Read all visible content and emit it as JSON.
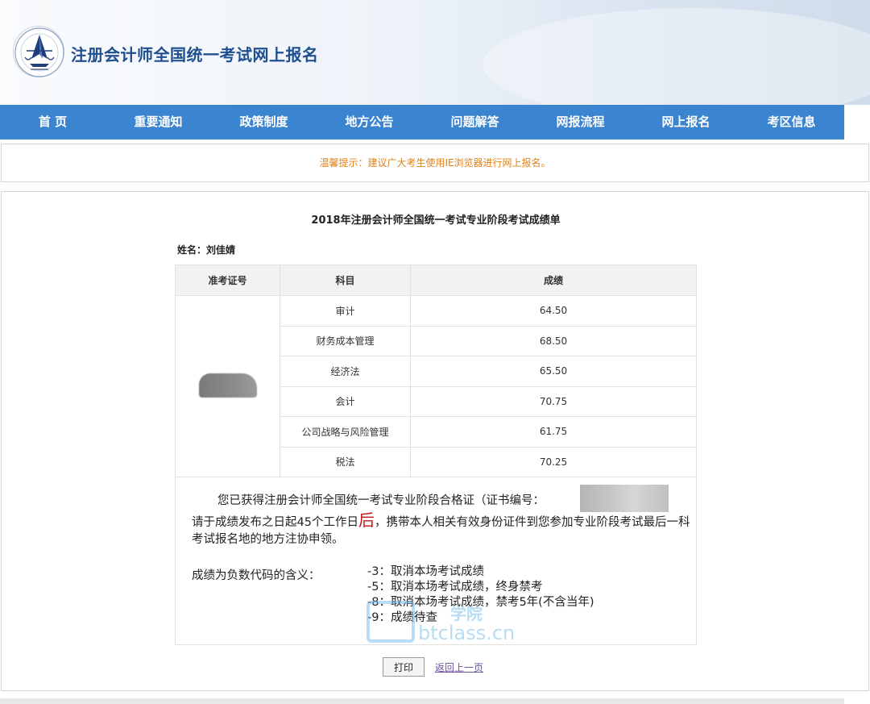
{
  "header": {
    "site_title": "注册会计师全国统一考试网上报名",
    "logo_icon": "cicpa-emblem-icon"
  },
  "nav": {
    "items": [
      "首 页",
      "重要通知",
      "政策制度",
      "地方公告",
      "问题解答",
      "网报流程",
      "网上报名",
      "考区信息"
    ]
  },
  "notice": {
    "text": "温馨提示：建议广大考生使用IE浏览器进行网上报名。"
  },
  "report": {
    "title": "2018年注册会计师全国统一考试专业阶段考试成绩单",
    "name_line": "姓名：刘佳婧",
    "headers": [
      "准考证号",
      "科目",
      "成绩"
    ],
    "rows": [
      {
        "subject": "审计",
        "score": "64.50"
      },
      {
        "subject": "财务成本管理",
        "score": "68.50"
      },
      {
        "subject": "经济法",
        "score": "65.50"
      },
      {
        "subject": "会计",
        "score": "70.75"
      },
      {
        "subject": "公司战略与风险管理",
        "score": "61.75"
      },
      {
        "subject": "税法",
        "score": "70.25"
      }
    ],
    "cert_text": "您已获得注册会计师全国统一考试专业阶段合格证（证书编号：",
    "collect_pre": "请于成绩发布之日起45个工作日",
    "collect_big": "后",
    "collect_post": "，携带本人相关有效身份证件到您参加专业阶段考试最后一科考试报名地的地方注协申领。",
    "codes_label": "成绩为负数代码的含义：",
    "codes": [
      "-3：取消本场考试成绩",
      "-5：取消本场考试成绩，终身禁考",
      "-8：取消本场考试成绩，禁考5年(不含当年)",
      "-9：成绩待查"
    ]
  },
  "watermark": {
    "top": "学院",
    "sub": "btclass.cn"
  },
  "actions": {
    "print_label": "打印",
    "back_label": "返回上一页"
  },
  "colors": {
    "nav_bg": "#3a84d0",
    "title_blue": "#1f4f8f",
    "notice_orange": "#e0821c",
    "highlight_red": "#c8161d"
  }
}
